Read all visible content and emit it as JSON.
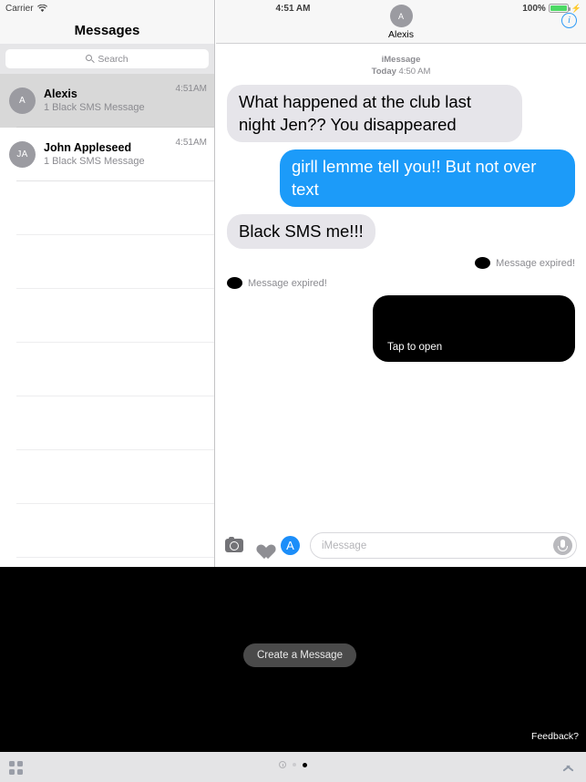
{
  "status_bar": {
    "carrier": "Carrier",
    "wifi_icon": "wifi-icon",
    "time": "4:51 AM",
    "battery_percent": "100%",
    "battery_icon": "battery-icon",
    "charging_icon": "lightning-bolt-icon"
  },
  "sidebar": {
    "title": "Messages",
    "search": {
      "placeholder": "Search",
      "icon": "search-icon"
    },
    "conversations": [
      {
        "avatar_initials": "A",
        "name": "Alexis",
        "preview": "1 Black SMS Message",
        "time": "4:51AM",
        "selected": true
      },
      {
        "avatar_initials": "JA",
        "name": "John Appleseed",
        "preview": "1 Black SMS Message",
        "time": "4:51AM",
        "selected": false
      }
    ],
    "empty_row_count": 7
  },
  "conversation": {
    "header": {
      "avatar_initials": "A",
      "name": "Alexis",
      "info_button": "i"
    },
    "meta": {
      "service": "iMessage",
      "day": "Today",
      "time": "4:50 AM",
      "full": "Today 4:50 AM"
    },
    "messages": [
      {
        "type": "bubble",
        "direction": "in",
        "text": "What happened at the club last night Jen?? You disappeared"
      },
      {
        "type": "bubble",
        "direction": "out",
        "text": "girll lemme tell you!! But not over text"
      },
      {
        "type": "bubble",
        "direction": "in",
        "text": "Black SMS me!!!"
      },
      {
        "type": "expired",
        "direction": "out",
        "text": "Message expired!",
        "icon": "black-ellipse-icon"
      },
      {
        "type": "expired",
        "direction": "in",
        "text": "Message expired!",
        "icon": "black-ellipse-icon"
      },
      {
        "type": "black-bubble",
        "direction": "out",
        "text": "Tap to open"
      }
    ],
    "compose": {
      "camera_icon": "camera-icon",
      "digital_touch_icon": "heart-icon",
      "app_store_icon": "app-store-icon",
      "input_placeholder": "iMessage",
      "mic_icon": "microphone-icon"
    }
  },
  "extension_panel": {
    "create_button": "Create a Message",
    "feedback_link": "Feedback?"
  },
  "drawer": {
    "apps_grid_icon": "app-grid-icon",
    "recents_icon": "recents-clock-icon",
    "page_dots": 2,
    "active_page": 2,
    "expand_icon": "chevron-up-icon"
  },
  "colors": {
    "accent_blue": "#1c9bf9",
    "incoming_bubble": "#e6e5ea",
    "battery_green": "#4cd964",
    "black_panel": "#000000"
  }
}
